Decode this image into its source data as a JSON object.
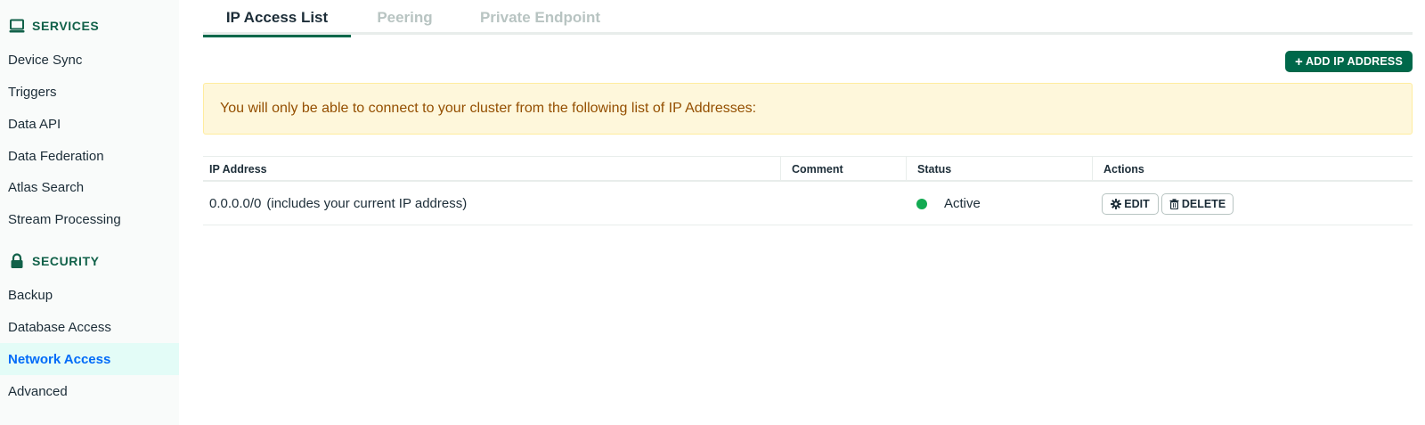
{
  "sidebar": {
    "services": {
      "icon": "laptop-icon",
      "label": "SERVICES",
      "items": [
        "Device Sync",
        "Triggers",
        "Data API",
        "Data Federation",
        "Atlas Search",
        "Stream Processing"
      ]
    },
    "security": {
      "icon": "lock-icon",
      "label": "SECURITY",
      "items": [
        "Backup",
        "Database Access",
        "Network Access",
        "Advanced"
      ]
    },
    "active_item": "Network Access"
  },
  "tabs": [
    {
      "label": "IP Access List",
      "active": true
    },
    {
      "label": "Peering",
      "active": false
    },
    {
      "label": "Private Endpoint",
      "active": false
    }
  ],
  "add_button": {
    "label": "ADD IP ADDRESS",
    "icon": "plus-icon"
  },
  "banner": {
    "text": "You will only be able to connect to your cluster from the following list of IP Addresses:"
  },
  "table": {
    "columns": [
      "IP Address",
      "Comment",
      "Status",
      "Actions"
    ],
    "rows": [
      {
        "ip_address": "0.0.0.0/0",
        "ip_note": "(includes your current IP address)",
        "comment": "",
        "status": "Active",
        "edit_label": "EDIT",
        "delete_label": "DELETE"
      }
    ]
  },
  "colors": {
    "accent": "#00684a",
    "sidebar_heading": "#116149",
    "active_link": "#016bf8",
    "active_bg": "#e3fcf7",
    "status_active": "#13aa52",
    "banner_bg": "#fef7db",
    "banner_text": "#944f01"
  }
}
